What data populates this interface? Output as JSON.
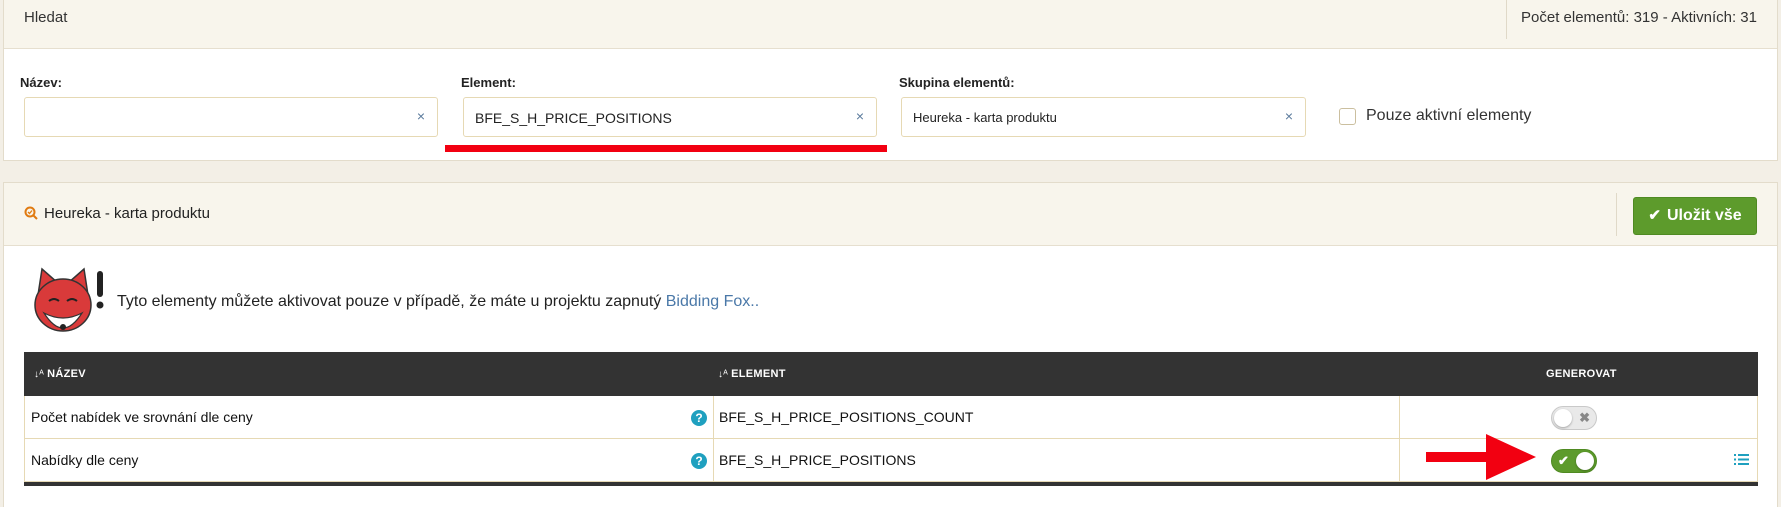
{
  "search": {
    "title": "Hledat",
    "counts": "Počet elementů: 319 - Aktivních: 31",
    "name_label": "Název:",
    "name_value": "",
    "element_label": "Element:",
    "element_value": "BFE_S_H_PRICE_POSITIONS",
    "group_label": "Skupina elementů:",
    "group_value": "Heureka - karta produktu",
    "clear_glyph": "×",
    "active_only_label": "Pouze aktivní elementy"
  },
  "group": {
    "title": "Heureka - karta produktu",
    "save_label": "Uložit vše",
    "info_text": "Tyto elementy můžete aktivovat pouze v případě, že máte u projektu zapnutý",
    "info_link": "Bidding Fox",
    "info_suffix": ".."
  },
  "table": {
    "columns": {
      "name": "NÁZEV",
      "element": "ELEMENT",
      "generate": "GENEROVAT"
    },
    "rows": [
      {
        "name": "Počet nabídek ve srovnání dle ceny",
        "element": "BFE_S_H_PRICE_POSITIONS_COUNT",
        "generate": false
      },
      {
        "name": "Nabídky dle ceny",
        "element": "BFE_S_H_PRICE_POSITIONS",
        "generate": true
      }
    ]
  },
  "colors": {
    "accent_green": "#5d9b2c",
    "highlight_red": "#f20011",
    "help_blue": "#1fa0bf",
    "link_blue": "#4a78a8"
  },
  "icons": [
    "clear-icon",
    "search-group-icon",
    "check-icon",
    "fox-logo",
    "help-icon",
    "toggle-check-icon",
    "toggle-x-icon",
    "list-icon",
    "sort-icon",
    "arrow-annotation"
  ]
}
